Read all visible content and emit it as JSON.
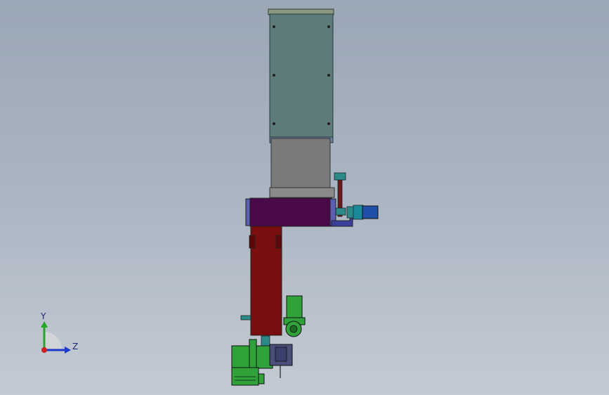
{
  "view": {
    "background_top": "#9aa7b6",
    "background_bottom": "#c3cad3"
  },
  "model": {
    "components": [
      {
        "name": "upper-housing",
        "color": "#5d7b78"
      },
      {
        "name": "middle-block",
        "color": "#7a7a7a"
      },
      {
        "name": "bearing-box",
        "color": "#4a0a4a"
      },
      {
        "name": "lower-column",
        "color": "#7a0e0e"
      },
      {
        "name": "side-motor",
        "color": "#1f4fa8"
      },
      {
        "name": "gear-motors",
        "color": "#2fa23a"
      }
    ]
  },
  "triad": {
    "y_label": "Y",
    "z_label": "Z",
    "y_color": "#22aa22",
    "z_color": "#1a3acc",
    "x_color": "#cc2222"
  }
}
